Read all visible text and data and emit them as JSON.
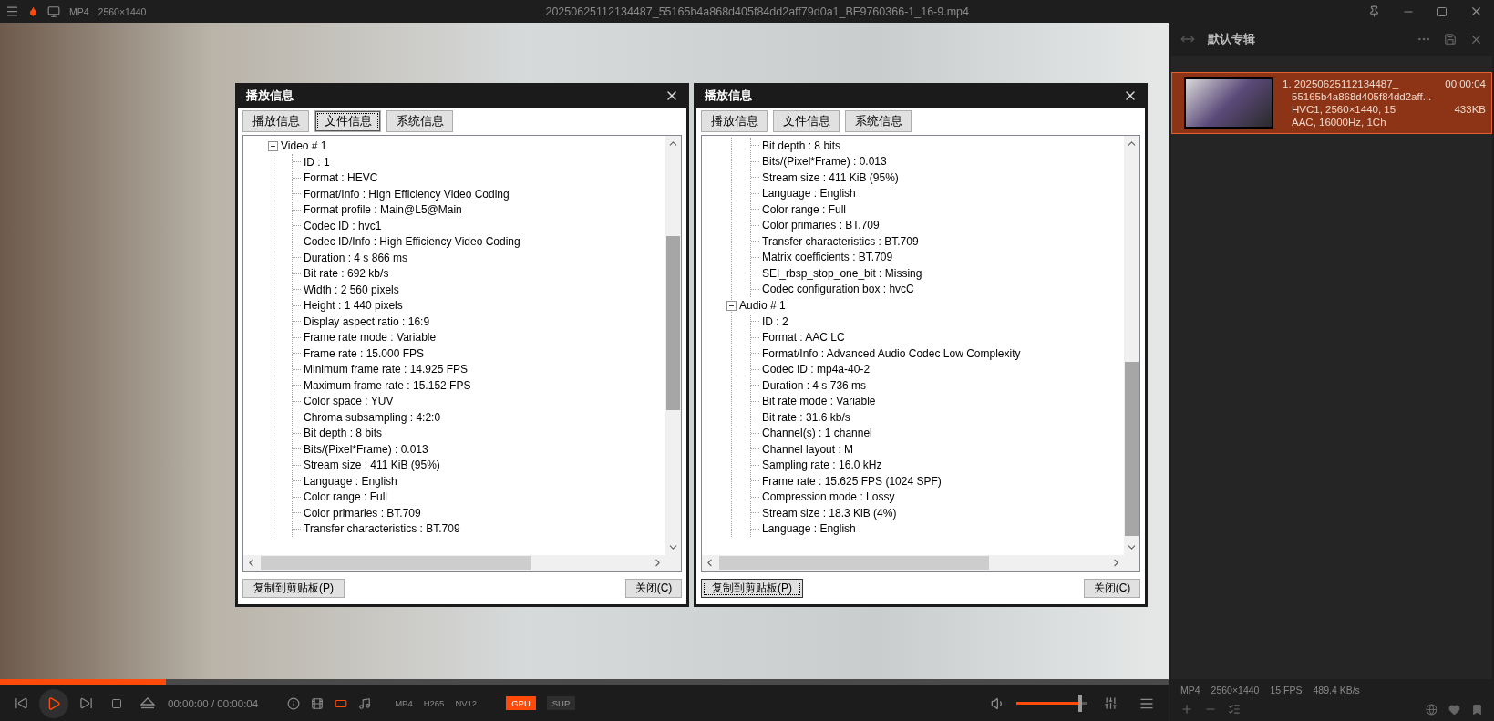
{
  "top_bar": {
    "format": "MP4",
    "resolution": "2560×1440",
    "title": "20250625112134487_55165b4a868d405f84dd2aff79d0a1_BF9760366-1_16-9.mp4"
  },
  "dialogs": [
    {
      "title": "播放信息",
      "tabs": [
        {
          "label": "播放信息",
          "focused": false
        },
        {
          "label": "文件信息",
          "focused": true
        },
        {
          "label": "系统信息",
          "focused": false
        }
      ],
      "tree": [
        {
          "kind": "node",
          "label": "Video # 1",
          "expanded": true,
          "children": [
            "ID : 1",
            "Format : HEVC",
            "Format/Info : High Efficiency Video Coding",
            "Format profile : Main@L5@Main",
            "Codec ID : hvc1",
            "Codec ID/Info : High Efficiency Video Coding",
            "Duration : 4 s 866 ms",
            "Bit rate : 692 kb/s",
            "Width : 2 560 pixels",
            "Height : 1 440 pixels",
            "Display aspect ratio : 16:9",
            "Frame rate mode : Variable",
            "Frame rate : 15.000 FPS",
            "Minimum frame rate : 14.925 FPS",
            "Maximum frame rate : 15.152 FPS",
            "Color space : YUV",
            "Chroma subsampling : 4:2:0",
            "Bit depth : 8 bits",
            "Bits/(Pixel*Frame) : 0.013",
            "Stream size : 411 KiB (95%)",
            "Language : English",
            "Color range : Full",
            "Color primaries : BT.709",
            "Transfer characteristics : BT.709"
          ]
        }
      ],
      "buttons": [
        {
          "label": "复制到剪贴板(P)",
          "focused": false
        },
        {
          "label": "关闭(C)",
          "focused": false
        }
      ]
    },
    {
      "title": "播放信息",
      "tabs": [
        {
          "label": "播放信息",
          "focused": false
        },
        {
          "label": "文件信息",
          "focused": false
        },
        {
          "label": "系统信息",
          "focused": false
        }
      ],
      "tree": [
        {
          "kind": "continued",
          "children": [
            "Bit depth : 8 bits",
            "Bits/(Pixel*Frame) : 0.013",
            "Stream size : 411 KiB (95%)",
            "Language : English",
            "Color range : Full",
            "Color primaries : BT.709",
            "Transfer characteristics : BT.709",
            "Matrix coefficients : BT.709",
            "SEI_rbsp_stop_one_bit : Missing",
            "Codec configuration box : hvcC"
          ]
        },
        {
          "kind": "node",
          "label": "Audio # 1",
          "expanded": true,
          "children": [
            "ID : 2",
            "Format : AAC LC",
            "Format/Info : Advanced Audio Codec Low Complexity",
            "Codec ID : mp4a-40-2",
            "Duration : 4 s 736 ms",
            "Bit rate mode : Variable",
            "Bit rate : 31.6 kb/s",
            "Channel(s) : 1 channel",
            "Channel layout : M",
            "Sampling rate : 16.0 kHz",
            "Frame rate : 15.625 FPS (1024 SPF)",
            "Compression mode : Lossy",
            "Stream size : 18.3 KiB (4%)",
            "Language : English"
          ]
        }
      ],
      "buttons": [
        {
          "label": "复制到剪贴板(P)",
          "focused": true
        },
        {
          "label": "关闭(C)",
          "focused": false
        }
      ]
    }
  ],
  "sidebar": {
    "title": "默认专辑",
    "playlist": [
      {
        "selected": true,
        "title": "1. 20250625112134487_",
        "subtitle": "55165b4a868d405f84dd2aff...",
        "video_info": "HVC1, 2560×1440, 15",
        "audio_info": "AAC, 16000Hz, 1Ch",
        "duration": "00:00:04",
        "size": "433KB"
      }
    ],
    "status": [
      "MP4",
      "2560×1440",
      "15 FPS",
      "489.4 KB/s"
    ]
  },
  "player": {
    "progress": {
      "level": 0.142
    },
    "time": "00:00:00 / 00:00:04",
    "tools": [
      {
        "kind": "info",
        "active": false
      },
      {
        "kind": "film",
        "active": false
      },
      {
        "kind": "screen",
        "active": true
      },
      {
        "kind": "music",
        "active": false
      }
    ],
    "formats": [
      "MP4",
      "H265",
      "NV12"
    ],
    "badges": [
      {
        "label": "GPU",
        "active": true
      },
      {
        "label": "SUP",
        "active": false
      }
    ],
    "volume": {
      "level": 0.9
    }
  }
}
